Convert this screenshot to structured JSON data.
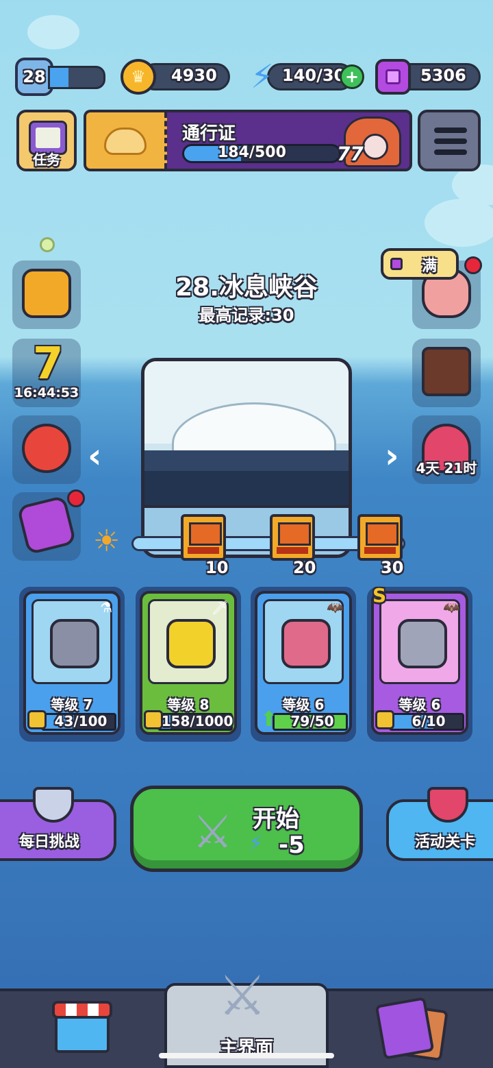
{
  "top_bar": {
    "player_level": "28",
    "player_xp_fraction": 0.35,
    "coins": "4930",
    "energy": "140/30",
    "gems": "5306"
  },
  "task_button": {
    "label": "任务",
    "icon": "clipboard-icon"
  },
  "battle_pass": {
    "title": "通行证",
    "progress_text": "184/500",
    "progress_fraction": 0.368,
    "level": "77"
  },
  "side_left": [
    {
      "name": "fund-chart-icon"
    },
    {
      "name": "seven-day-icon",
      "timer": "16:44:53"
    },
    {
      "name": "target-icon"
    },
    {
      "name": "s-card-icon"
    }
  ],
  "side_right": [
    {
      "name": "piggy-bank-icon",
      "tag": "满"
    },
    {
      "name": "coffin-icon"
    },
    {
      "name": "event-hero-icon",
      "timer": "4天 21时"
    }
  ],
  "stage": {
    "title": "28.冰息峡谷",
    "record": "最高记录:30"
  },
  "milestones": [
    {
      "label": "10"
    },
    {
      "label": "20"
    },
    {
      "label": "30"
    }
  ],
  "heroes": [
    {
      "level": "等级 7",
      "progress": "43/100",
      "progress_fraction": 0.43,
      "color": "#4aa0ec",
      "corner_icon": "potion-icon"
    },
    {
      "level": "等级 8",
      "progress": "158/1000",
      "progress_fraction": 0.158,
      "color": "#6bbd3e",
      "corner_icon": "sword-icon"
    },
    {
      "level": "等级 6",
      "progress": "79/50",
      "progress_fraction": 1.0,
      "color": "#4aa0ec",
      "corner_icon": "bat-icon"
    },
    {
      "level": "等级 6",
      "progress": "6/10",
      "progress_fraction": 0.6,
      "color": "#a75be0",
      "corner_icon": "bat-icon",
      "rank": "S"
    }
  ],
  "actions": {
    "daily": "每日挑战",
    "start": "开始",
    "start_cost": "-5",
    "event": "活动关卡"
  },
  "nav": {
    "main": "主界面"
  }
}
